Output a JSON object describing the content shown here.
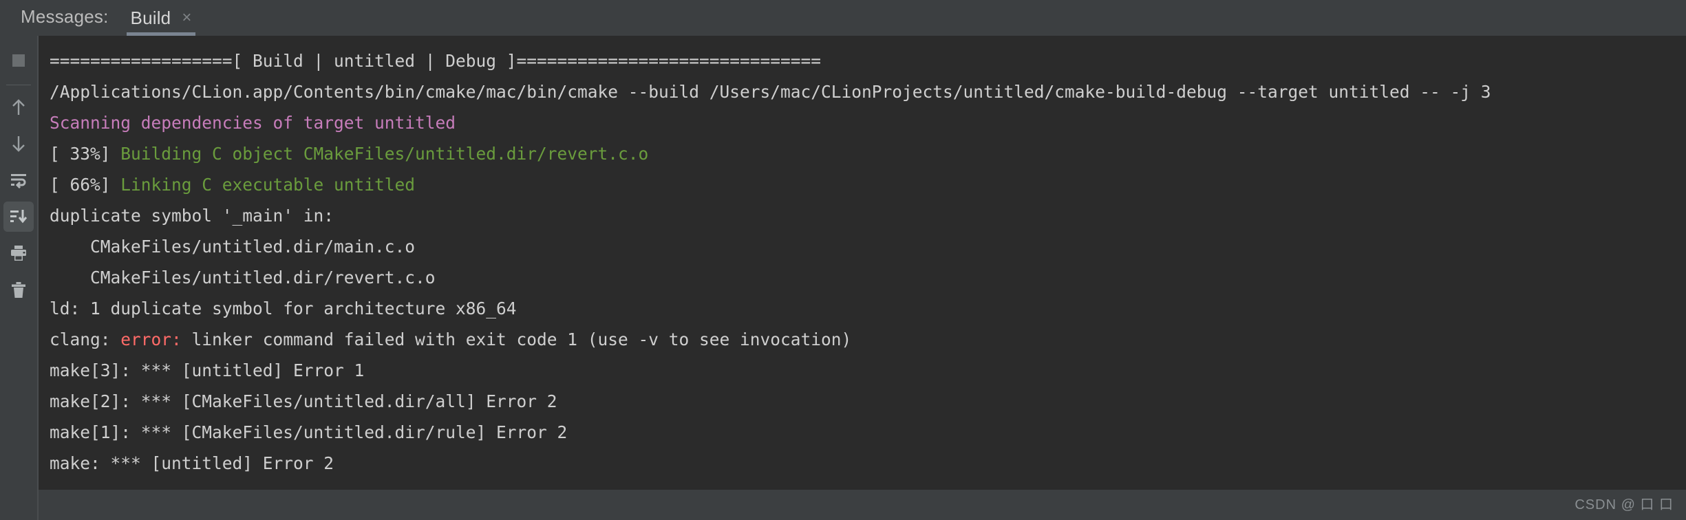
{
  "tabbar": {
    "group_label": "Messages:",
    "tab": {
      "title": "Build",
      "close_icon": "×"
    }
  },
  "sidebar": {
    "items": [
      {
        "name": "stop-button",
        "icon": "stop-icon",
        "selected": false
      },
      {
        "name": "up-button",
        "icon": "arrow-up-icon",
        "selected": false
      },
      {
        "name": "down-button",
        "icon": "arrow-down-icon",
        "selected": false
      },
      {
        "name": "soft-wrap-button",
        "icon": "soft-wrap-icon",
        "selected": false
      },
      {
        "name": "scroll-to-end-button",
        "icon": "scroll-to-end-icon",
        "selected": true
      },
      {
        "name": "print-button",
        "icon": "print-icon",
        "selected": false
      },
      {
        "name": "clear-all-button",
        "icon": "trash-icon",
        "selected": false
      }
    ]
  },
  "console": {
    "lines": [
      {
        "id": "line-header",
        "segments": [
          {
            "text": "==================[ Build | untitled | Debug ]==============================",
            "color": "white"
          }
        ]
      },
      {
        "id": "line-cmake-command",
        "segments": [
          {
            "text": "/Applications/CLion.app/Contents/bin/cmake/mac/bin/cmake --build /Users/mac/CLionProjects/untitled/cmake-build-debug --target untitled -- -j 3",
            "color": "white"
          }
        ]
      },
      {
        "id": "line-scanning",
        "segments": [
          {
            "text": "Scanning dependencies of target untitled",
            "color": "purple"
          }
        ]
      },
      {
        "id": "line-build-33",
        "segments": [
          {
            "text": "[ 33%] ",
            "color": "white"
          },
          {
            "text": "Building C object CMakeFiles/untitled.dir/revert.c.o",
            "color": "green"
          }
        ]
      },
      {
        "id": "line-build-66",
        "segments": [
          {
            "text": "[ 66%] ",
            "color": "white"
          },
          {
            "text": "Linking C executable untitled",
            "color": "green"
          }
        ]
      },
      {
        "id": "line-duplicate-symbol",
        "segments": [
          {
            "text": "duplicate symbol '_main' in:",
            "color": "white"
          }
        ]
      },
      {
        "id": "line-main-obj",
        "segments": [
          {
            "text": "    CMakeFiles/untitled.dir/main.c.o",
            "color": "white"
          }
        ]
      },
      {
        "id": "line-revert-obj",
        "segments": [
          {
            "text": "    CMakeFiles/untitled.dir/revert.c.o",
            "color": "white"
          }
        ]
      },
      {
        "id": "line-ld-error",
        "segments": [
          {
            "text": "ld: 1 duplicate symbol for architecture x86_64",
            "color": "white"
          }
        ]
      },
      {
        "id": "line-clang-error",
        "segments": [
          {
            "text": "clang: ",
            "color": "white"
          },
          {
            "text": "error:",
            "color": "red"
          },
          {
            "text": " linker command failed with exit code 1 (use -v to see invocation)",
            "color": "white"
          }
        ]
      },
      {
        "id": "line-make3",
        "segments": [
          {
            "text": "make[3]: *** [untitled] Error 1",
            "color": "white"
          }
        ]
      },
      {
        "id": "line-make2",
        "segments": [
          {
            "text": "make[2]: *** [CMakeFiles/untitled.dir/all] Error 2",
            "color": "white"
          }
        ]
      },
      {
        "id": "line-make1",
        "segments": [
          {
            "text": "make[1]: *** [CMakeFiles/untitled.dir/rule] Error 2",
            "color": "white"
          }
        ]
      },
      {
        "id": "line-make",
        "segments": [
          {
            "text": "make: *** [untitled] Error 2",
            "color": "white"
          }
        ]
      }
    ]
  },
  "watermark": {
    "text": "CSDN @ 口 口"
  },
  "colors": {
    "background": "#3c3f41",
    "console_background": "#2b2b2b",
    "text": "#bdbdbd",
    "purple": "#c77dbb",
    "green": "#6a9c3d",
    "red": "#ff6b68",
    "tab_underline": "#7a8491",
    "selected_button": "#4e5254"
  }
}
